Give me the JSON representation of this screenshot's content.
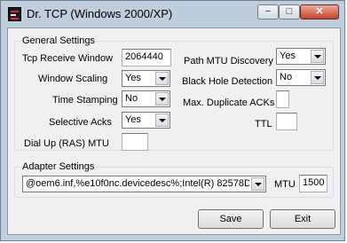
{
  "window": {
    "title": "Dr. TCP (Windows 2000/XP)",
    "minimize_glyph": "−",
    "maximize_glyph": "□",
    "close_glyph": "✕"
  },
  "general": {
    "title": "General Settings",
    "tcp_receive_window": {
      "label": "Tcp Receive Window",
      "value": "2064440"
    },
    "window_scaling": {
      "label": "Window Scaling",
      "value": "Yes"
    },
    "time_stamping": {
      "label": "Time Stamping",
      "value": "No"
    },
    "selective_acks": {
      "label": "Selective Acks",
      "value": "Yes"
    },
    "dial_up_mtu": {
      "label": "Dial Up (RAS) MTU",
      "value": ""
    },
    "path_mtu_discovery": {
      "label": "Path MTU Discovery",
      "value": "Yes"
    },
    "black_hole_detection": {
      "label": "Black Hole Detection",
      "value": "No"
    },
    "max_duplicate_acks": {
      "label": "Max. Duplicate ACKs",
      "value": ""
    },
    "ttl": {
      "label": "TTL",
      "value": ""
    }
  },
  "adapter": {
    "title": "Adapter Settings",
    "selected": "@oem6.inf,%e10f0nc.devicedesc%;Intel(R) 82578D",
    "mtu_label": "MTU",
    "mtu_value": "1500"
  },
  "buttons": {
    "save": "Save",
    "exit": "Exit"
  },
  "icons": {
    "app": "dr-tcp-app-icon",
    "dropdown": "chevron-down-icon"
  }
}
